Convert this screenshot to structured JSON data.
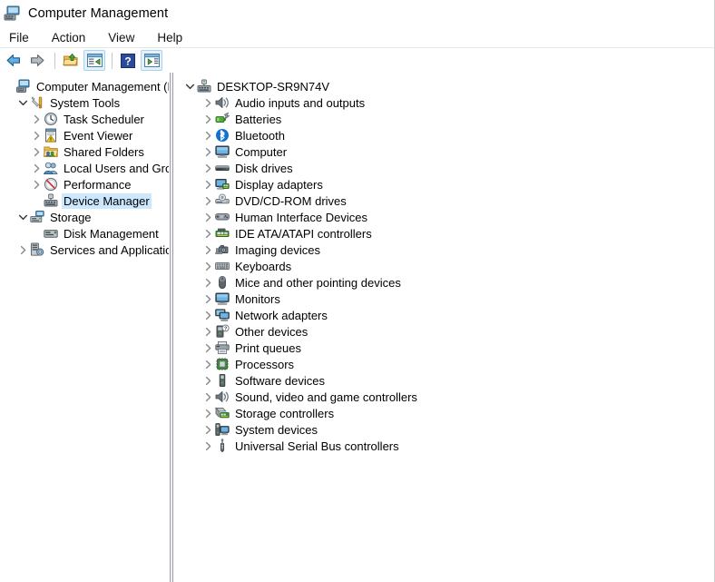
{
  "window": {
    "title": "Computer Management",
    "icon": "computer-management-icon"
  },
  "menubar": {
    "items": [
      {
        "label": "File",
        "name": "menu-file"
      },
      {
        "label": "Action",
        "name": "menu-action"
      },
      {
        "label": "View",
        "name": "menu-view"
      },
      {
        "label": "Help",
        "name": "menu-help"
      }
    ]
  },
  "toolbar": {
    "buttons": [
      {
        "name": "back-button",
        "icon": "back-arrow-icon",
        "framed": false
      },
      {
        "name": "forward-button",
        "icon": "forward-arrow-icon",
        "framed": false
      },
      {
        "name": "up-one-level-button",
        "icon": "folder-up-icon",
        "framed": false
      },
      {
        "name": "show-hide-console-tree-button",
        "icon": "console-tree-icon",
        "framed": true
      },
      {
        "name": "help-button",
        "icon": "help-question-icon",
        "framed": false
      },
      {
        "name": "show-hide-action-pane-button",
        "icon": "action-pane-icon",
        "framed": true
      }
    ]
  },
  "left_tree": {
    "items": [
      {
        "label": "Computer Management (Local",
        "indent": 0,
        "chevron": "none",
        "icon": "computer-management-icon",
        "selected": false,
        "name": "tree-item-computer-management"
      },
      {
        "label": "System Tools",
        "indent": 1,
        "chevron": "expanded",
        "icon": "system-tools-icon",
        "selected": false,
        "name": "tree-item-system-tools"
      },
      {
        "label": "Task Scheduler",
        "indent": 2,
        "chevron": "collapsed",
        "icon": "task-scheduler-icon",
        "selected": false,
        "name": "tree-item-task-scheduler"
      },
      {
        "label": "Event Viewer",
        "indent": 2,
        "chevron": "collapsed",
        "icon": "event-viewer-icon",
        "selected": false,
        "name": "tree-item-event-viewer"
      },
      {
        "label": "Shared Folders",
        "indent": 2,
        "chevron": "collapsed",
        "icon": "shared-folders-icon",
        "selected": false,
        "name": "tree-item-shared-folders"
      },
      {
        "label": "Local Users and Groups",
        "indent": 2,
        "chevron": "collapsed",
        "icon": "local-users-groups-icon",
        "selected": false,
        "name": "tree-item-local-users-and-groups"
      },
      {
        "label": "Performance",
        "indent": 2,
        "chevron": "collapsed",
        "icon": "performance-icon",
        "selected": false,
        "name": "tree-item-performance"
      },
      {
        "label": "Device Manager",
        "indent": 2,
        "chevron": "none",
        "icon": "device-manager-icon",
        "selected": true,
        "name": "tree-item-device-manager"
      },
      {
        "label": "Storage",
        "indent": 1,
        "chevron": "expanded",
        "icon": "storage-icon",
        "selected": false,
        "name": "tree-item-storage"
      },
      {
        "label": "Disk Management",
        "indent": 2,
        "chevron": "none",
        "icon": "disk-management-icon",
        "selected": false,
        "name": "tree-item-disk-management"
      },
      {
        "label": "Services and Applications",
        "indent": 1,
        "chevron": "collapsed",
        "icon": "services-applications-icon",
        "selected": false,
        "name": "tree-item-services-and-applications"
      }
    ]
  },
  "right_tree": {
    "items": [
      {
        "label": "DESKTOP-SR9N74V",
        "indent": 0,
        "chevron": "expanded",
        "icon": "computer-node-icon",
        "name": "device-node-desktop"
      },
      {
        "label": "Audio inputs and outputs",
        "indent": 1,
        "chevron": "collapsed",
        "icon": "audio-speaker-icon",
        "name": "device-category-audio-inputs-and-outputs"
      },
      {
        "label": "Batteries",
        "indent": 1,
        "chevron": "collapsed",
        "icon": "battery-icon",
        "name": "device-category-batteries"
      },
      {
        "label": "Bluetooth",
        "indent": 1,
        "chevron": "collapsed",
        "icon": "bluetooth-icon",
        "name": "device-category-bluetooth"
      },
      {
        "label": "Computer",
        "indent": 1,
        "chevron": "collapsed",
        "icon": "monitor-icon",
        "name": "device-category-computer"
      },
      {
        "label": "Disk drives",
        "indent": 1,
        "chevron": "collapsed",
        "icon": "disk-drive-icon",
        "name": "device-category-disk-drives"
      },
      {
        "label": "Display adapters",
        "indent": 1,
        "chevron": "collapsed",
        "icon": "display-adapter-icon",
        "name": "device-category-display-adapters"
      },
      {
        "label": "DVD/CD-ROM drives",
        "indent": 1,
        "chevron": "collapsed",
        "icon": "optical-drive-icon",
        "name": "device-category-dvd-cd-rom-drives"
      },
      {
        "label": "Human Interface Devices",
        "indent": 1,
        "chevron": "collapsed",
        "icon": "hid-gamepad-icon",
        "name": "device-category-human-interface-devices"
      },
      {
        "label": "IDE ATA/ATAPI controllers",
        "indent": 1,
        "chevron": "collapsed",
        "icon": "ide-controller-icon",
        "name": "device-category-ide-ata-atapi-controllers"
      },
      {
        "label": "Imaging devices",
        "indent": 1,
        "chevron": "collapsed",
        "icon": "camera-icon",
        "name": "device-category-imaging-devices"
      },
      {
        "label": "Keyboards",
        "indent": 1,
        "chevron": "collapsed",
        "icon": "keyboard-icon",
        "name": "device-category-keyboards"
      },
      {
        "label": "Mice and other pointing devices",
        "indent": 1,
        "chevron": "collapsed",
        "icon": "mouse-icon",
        "name": "device-category-mice-and-other-pointing-devices"
      },
      {
        "label": "Monitors",
        "indent": 1,
        "chevron": "collapsed",
        "icon": "monitor-icon",
        "name": "device-category-monitors"
      },
      {
        "label": "Network adapters",
        "indent": 1,
        "chevron": "collapsed",
        "icon": "network-adapter-icon",
        "name": "device-category-network-adapters"
      },
      {
        "label": "Other devices",
        "indent": 1,
        "chevron": "collapsed",
        "icon": "unknown-device-icon",
        "name": "device-category-other-devices"
      },
      {
        "label": "Print queues",
        "indent": 1,
        "chevron": "collapsed",
        "icon": "printer-icon",
        "name": "device-category-print-queues"
      },
      {
        "label": "Processors",
        "indent": 1,
        "chevron": "collapsed",
        "icon": "processor-icon",
        "name": "device-category-processors"
      },
      {
        "label": "Software devices",
        "indent": 1,
        "chevron": "collapsed",
        "icon": "software-device-icon",
        "name": "device-category-software-devices"
      },
      {
        "label": "Sound, video and game controllers",
        "indent": 1,
        "chevron": "collapsed",
        "icon": "audio-speaker-icon",
        "name": "device-category-sound-video-and-game-controllers"
      },
      {
        "label": "Storage controllers",
        "indent": 1,
        "chevron": "collapsed",
        "icon": "storage-controller-icon",
        "name": "device-category-storage-controllers"
      },
      {
        "label": "System devices",
        "indent": 1,
        "chevron": "collapsed",
        "icon": "system-device-icon",
        "name": "device-category-system-devices"
      },
      {
        "label": "Universal Serial Bus controllers",
        "indent": 1,
        "chevron": "collapsed",
        "icon": "usb-icon",
        "name": "device-category-universal-serial-bus-controllers"
      }
    ]
  },
  "colors": {
    "selection": "#cce8ff",
    "toolbar_frame": "#a8d3f0",
    "window_bg": "#ffffff",
    "splitter": "#f0f0f0"
  }
}
